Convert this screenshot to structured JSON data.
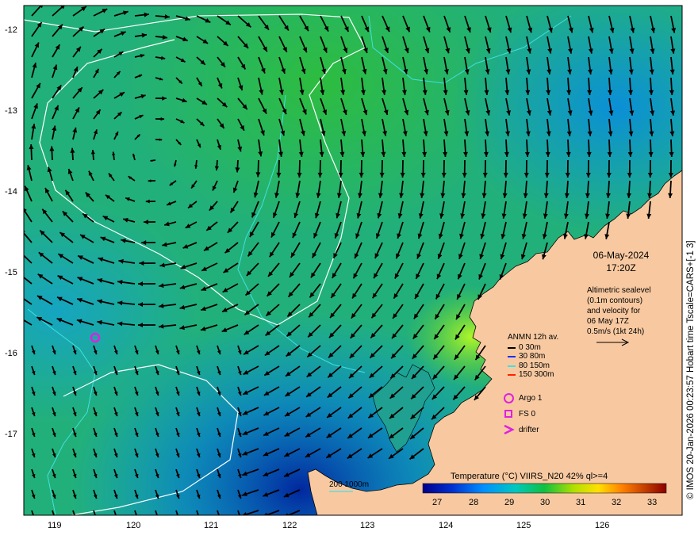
{
  "map": {
    "lon_ticks": [
      "119",
      "120",
      "121",
      "122",
      "123",
      "124",
      "125",
      "126"
    ],
    "lat_ticks": [
      "-12",
      "-13",
      "-14",
      "-15",
      "-16",
      "-17"
    ],
    "land_color": "#f8c9a0",
    "ocean_base_color": "#22b07a"
  },
  "annotation": {
    "date": "06-May-2024",
    "time": "17:20Z",
    "alt_line1": "Altimetric sealevel",
    "alt_line2": "(0.1m contours)",
    "alt_line3": "and velocity for",
    "alt_line4": "06 May 17Z",
    "alt_line5": "0.5m/s (1kt 24h)"
  },
  "anmn": {
    "title": "ANMN 12h av.",
    "items": [
      {
        "label": "0 30m",
        "color": "#000000"
      },
      {
        "label": "30 80m",
        "color": "#1030ff"
      },
      {
        "label": "80 150m",
        "color": "#40e0e0"
      },
      {
        "label": "150 300m",
        "color": "#ff2000"
      }
    ]
  },
  "markers": {
    "argo": "Argo 1",
    "fs": "FS 0",
    "drifter": "drifter",
    "color": "#e020e0"
  },
  "colorbar": {
    "title": "Temperature (°C) VIIRS_N20 42% ql>=4",
    "ticks": [
      "27",
      "28",
      "29",
      "30",
      "31",
      "32",
      "33"
    ]
  },
  "contour_key": {
    "label": "200  1000m"
  },
  "credit": "© IMOS 20-Jan-2026 00:23:57 Hobart time Tscale=CARS+[-1 3]"
}
